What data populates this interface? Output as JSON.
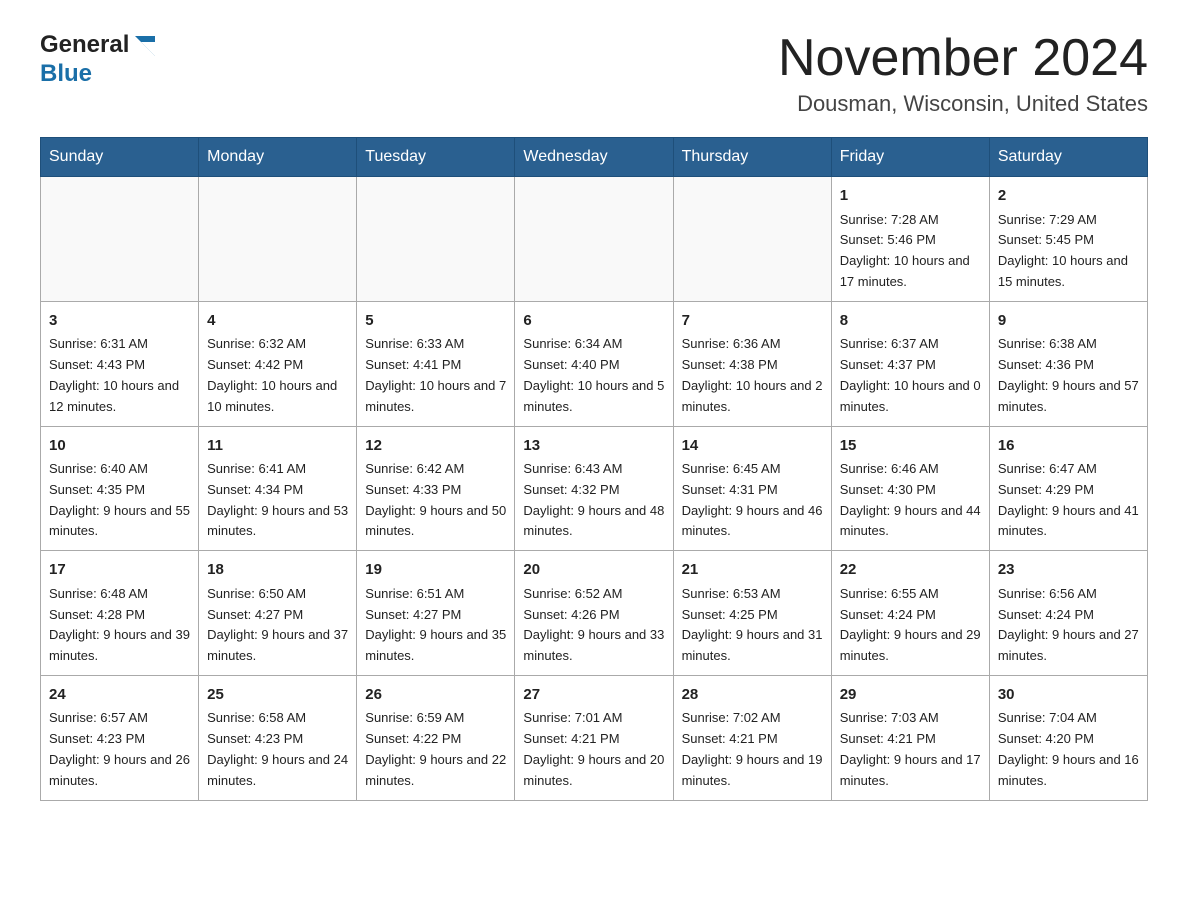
{
  "header": {
    "logo": {
      "general": "General",
      "blue": "Blue"
    },
    "title": "November 2024",
    "subtitle": "Dousman, Wisconsin, United States"
  },
  "weekdays": [
    "Sunday",
    "Monday",
    "Tuesday",
    "Wednesday",
    "Thursday",
    "Friday",
    "Saturday"
  ],
  "weeks": [
    [
      {
        "day": "",
        "info": ""
      },
      {
        "day": "",
        "info": ""
      },
      {
        "day": "",
        "info": ""
      },
      {
        "day": "",
        "info": ""
      },
      {
        "day": "",
        "info": ""
      },
      {
        "day": "1",
        "info": "Sunrise: 7:28 AM\nSunset: 5:46 PM\nDaylight: 10 hours and 17 minutes."
      },
      {
        "day": "2",
        "info": "Sunrise: 7:29 AM\nSunset: 5:45 PM\nDaylight: 10 hours and 15 minutes."
      }
    ],
    [
      {
        "day": "3",
        "info": "Sunrise: 6:31 AM\nSunset: 4:43 PM\nDaylight: 10 hours and 12 minutes."
      },
      {
        "day": "4",
        "info": "Sunrise: 6:32 AM\nSunset: 4:42 PM\nDaylight: 10 hours and 10 minutes."
      },
      {
        "day": "5",
        "info": "Sunrise: 6:33 AM\nSunset: 4:41 PM\nDaylight: 10 hours and 7 minutes."
      },
      {
        "day": "6",
        "info": "Sunrise: 6:34 AM\nSunset: 4:40 PM\nDaylight: 10 hours and 5 minutes."
      },
      {
        "day": "7",
        "info": "Sunrise: 6:36 AM\nSunset: 4:38 PM\nDaylight: 10 hours and 2 minutes."
      },
      {
        "day": "8",
        "info": "Sunrise: 6:37 AM\nSunset: 4:37 PM\nDaylight: 10 hours and 0 minutes."
      },
      {
        "day": "9",
        "info": "Sunrise: 6:38 AM\nSunset: 4:36 PM\nDaylight: 9 hours and 57 minutes."
      }
    ],
    [
      {
        "day": "10",
        "info": "Sunrise: 6:40 AM\nSunset: 4:35 PM\nDaylight: 9 hours and 55 minutes."
      },
      {
        "day": "11",
        "info": "Sunrise: 6:41 AM\nSunset: 4:34 PM\nDaylight: 9 hours and 53 minutes."
      },
      {
        "day": "12",
        "info": "Sunrise: 6:42 AM\nSunset: 4:33 PM\nDaylight: 9 hours and 50 minutes."
      },
      {
        "day": "13",
        "info": "Sunrise: 6:43 AM\nSunset: 4:32 PM\nDaylight: 9 hours and 48 minutes."
      },
      {
        "day": "14",
        "info": "Sunrise: 6:45 AM\nSunset: 4:31 PM\nDaylight: 9 hours and 46 minutes."
      },
      {
        "day": "15",
        "info": "Sunrise: 6:46 AM\nSunset: 4:30 PM\nDaylight: 9 hours and 44 minutes."
      },
      {
        "day": "16",
        "info": "Sunrise: 6:47 AM\nSunset: 4:29 PM\nDaylight: 9 hours and 41 minutes."
      }
    ],
    [
      {
        "day": "17",
        "info": "Sunrise: 6:48 AM\nSunset: 4:28 PM\nDaylight: 9 hours and 39 minutes."
      },
      {
        "day": "18",
        "info": "Sunrise: 6:50 AM\nSunset: 4:27 PM\nDaylight: 9 hours and 37 minutes."
      },
      {
        "day": "19",
        "info": "Sunrise: 6:51 AM\nSunset: 4:27 PM\nDaylight: 9 hours and 35 minutes."
      },
      {
        "day": "20",
        "info": "Sunrise: 6:52 AM\nSunset: 4:26 PM\nDaylight: 9 hours and 33 minutes."
      },
      {
        "day": "21",
        "info": "Sunrise: 6:53 AM\nSunset: 4:25 PM\nDaylight: 9 hours and 31 minutes."
      },
      {
        "day": "22",
        "info": "Sunrise: 6:55 AM\nSunset: 4:24 PM\nDaylight: 9 hours and 29 minutes."
      },
      {
        "day": "23",
        "info": "Sunrise: 6:56 AM\nSunset: 4:24 PM\nDaylight: 9 hours and 27 minutes."
      }
    ],
    [
      {
        "day": "24",
        "info": "Sunrise: 6:57 AM\nSunset: 4:23 PM\nDaylight: 9 hours and 26 minutes."
      },
      {
        "day": "25",
        "info": "Sunrise: 6:58 AM\nSunset: 4:23 PM\nDaylight: 9 hours and 24 minutes."
      },
      {
        "day": "26",
        "info": "Sunrise: 6:59 AM\nSunset: 4:22 PM\nDaylight: 9 hours and 22 minutes."
      },
      {
        "day": "27",
        "info": "Sunrise: 7:01 AM\nSunset: 4:21 PM\nDaylight: 9 hours and 20 minutes."
      },
      {
        "day": "28",
        "info": "Sunrise: 7:02 AM\nSunset: 4:21 PM\nDaylight: 9 hours and 19 minutes."
      },
      {
        "day": "29",
        "info": "Sunrise: 7:03 AM\nSunset: 4:21 PM\nDaylight: 9 hours and 17 minutes."
      },
      {
        "day": "30",
        "info": "Sunrise: 7:04 AM\nSunset: 4:20 PM\nDaylight: 9 hours and 16 minutes."
      }
    ]
  ]
}
